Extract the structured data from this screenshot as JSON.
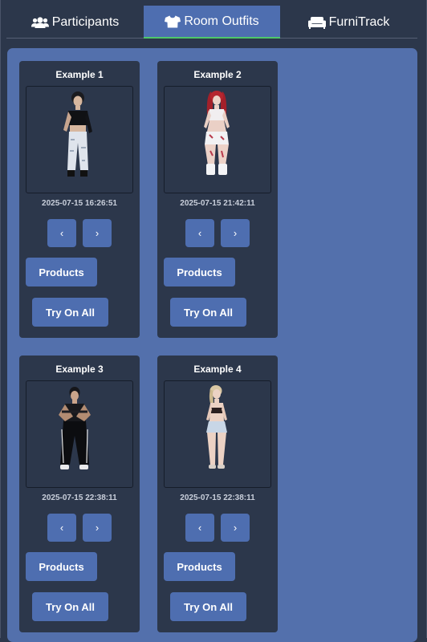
{
  "tabs": [
    {
      "label": "Participants",
      "icon": "users-icon",
      "active": false
    },
    {
      "label": "Room Outfits",
      "icon": "tshirt-icon",
      "active": true
    },
    {
      "label": "FurniTrack",
      "icon": "couch-icon",
      "active": false
    }
  ],
  "colors": {
    "background": "#2c374b",
    "panel": "#5370ac",
    "button": "#4e6eb0",
    "active_tab_underline": "#4ec86a"
  },
  "outfits": [
    {
      "title": "Example 1",
      "timestamp": "2025-07-15 16:26:51",
      "prev_label": "‹",
      "next_label": "›",
      "products_label": "Products",
      "tryon_label": "Try On All"
    },
    {
      "title": "Example 2",
      "timestamp": "2025-07-15 21:42:11",
      "prev_label": "‹",
      "next_label": "›",
      "products_label": "Products",
      "tryon_label": "Try On All"
    },
    {
      "title": "Example 3",
      "timestamp": "2025-07-15 22:38:11",
      "prev_label": "‹",
      "next_label": "›",
      "products_label": "Products",
      "tryon_label": "Try On All"
    },
    {
      "title": "Example 4",
      "timestamp": "2025-07-15 22:38:11",
      "prev_label": "‹",
      "next_label": "›",
      "products_label": "Products",
      "tryon_label": "Try On All"
    }
  ]
}
